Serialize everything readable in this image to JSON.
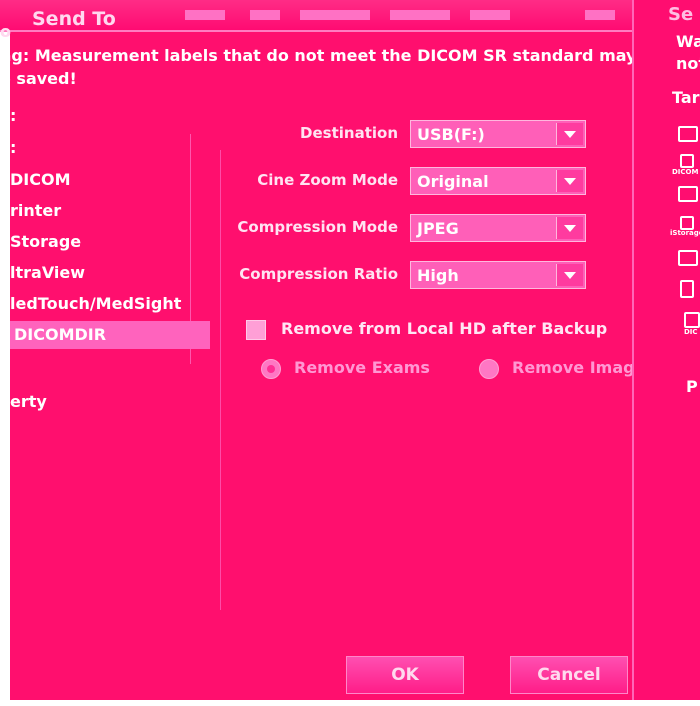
{
  "titlebar": {
    "title": "Send To",
    "title_stub": "o"
  },
  "warning": {
    "text": "ng: Measurement labels that do not meet the DICOM SR standard may",
    "text2": "e saved!"
  },
  "left_list": {
    "header_stub1": ":",
    "header_stub2": ":",
    "items": [
      "DICOM",
      "rinter",
      "Storage",
      "ltraView",
      "ledTouch/MedSight",
      "DICOMDIR"
    ],
    "selected_index": 5,
    "footer": "erty"
  },
  "form": {
    "destination_label": "Destination",
    "destination_value": "USB(F:)",
    "cine_label": "Cine Zoom Mode",
    "cine_value": "Original",
    "compression_mode_label": "Compression Mode",
    "compression_mode_value": "JPEG",
    "compression_ratio_label": "Compression Ratio",
    "compression_ratio_value": "High",
    "remove_checkbox_label": "Remove from Local HD after Backup",
    "remove_exams_label": "Remove Exams",
    "remove_images_label": "Remove Images"
  },
  "buttons": {
    "ok": "OK",
    "cancel": "Cancel"
  },
  "right_panel": {
    "title_stub": "Se",
    "line1": "Wa",
    "line2": "not",
    "target": "Tar",
    "icon_labels": [
      "DICOM",
      "iStorage",
      "DIC"
    ],
    "p_stub": "P"
  },
  "colors": {
    "background": "#ff0f6e",
    "selection": "#ff63bd",
    "accent": "#ff5fb8"
  }
}
